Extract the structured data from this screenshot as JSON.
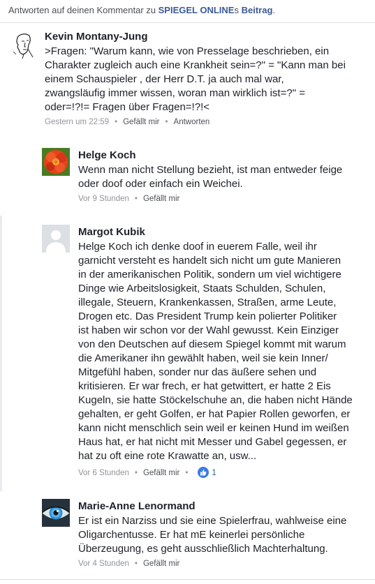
{
  "header": {
    "prefix": "Antworten auf deinen Kommentar zu ",
    "site": "SPIEGEL ONLINE",
    "suffix": "s ",
    "post": "Beitrag",
    "end": "."
  },
  "comments": [
    {
      "author": "Kevin Montany-Jung",
      "lines": [
        ">Fragen: \"Warum kann, wie  von Presselage beschrieben, ein",
        "Charakter zugleich  auch eine Krankheit sein=?\" = \"Kann man bei",
        "einem Schauspieler , der Herr D.T. ja auch mal war,",
        "zwangsläufig immer wissen, woran man wirklich ist=?\" =",
        "oder=!?!=  Fragen über Fragen=!?!<"
      ],
      "time": "Gestern um 22:59",
      "like": "Gefällt mir",
      "reply": "Antworten"
    },
    {
      "author": "Helge Koch",
      "lines": [
        "Wenn man nicht Stellung bezieht, ist man entweder feige",
        "oder doof oder einfach ein Weichei."
      ],
      "time": "Vor 9 Stunden",
      "like": "Gefällt mir"
    },
    {
      "author": "Margot Kubik",
      "lines": [
        "Helge Koch ich denke doof in euerem Falle, weil ihr",
        "garnicht versteht es handelt sich nicht um gute Manieren",
        "in der amerikanischen Politik, sondern um viel wichtigere",
        "Dinge wie Arbeitslosigkeit, Staats Schulden, Schulen,",
        "illegale, Steuern, Krankenkassen, Straßen, arme Leute,",
        "Drogen etc. Das President Trump kein polierter Politiker",
        "ist haben wir schon vor der Wahl gewusst. Kein Einziger",
        "von den Deutschen auf diesem Spiegel kommt mit warum",
        "die Amerikaner ihn gewählt haben, weil sie kein Inner/",
        "Mitgefühl haben, sonder nur das äußere sehen und",
        "kritisieren. Er war frech, er hat getwittert, er hatte 2 Eis",
        "Kugeln, sie hatte Stöckelschuhe an, die haben nicht Hände",
        "gehalten, er geht Golfen, er hat Papier Rollen geworfen, er",
        "kann nicht menschlich sein weil er keinen Hund im weißen",
        "Haus hat, er hat nicht mit Messer und Gabel gegessen, er",
        "hat zu oft eine rote Krawatte an, usw..."
      ],
      "time": "Vor 6 Stunden",
      "like": "Gefällt mir",
      "likes_count": "1"
    },
    {
      "author": "Marie-Anne Lenormand",
      "lines": [
        "Er ist ein Narziss und sie eine Spielerfrau, wahlweise eine",
        "Oligarchentusse. Er hat mE keinerlei persönliche",
        "Überzeugung, es geht ausschließlich Machterhaltung."
      ],
      "time": "Vor 4 Stunden",
      "like": "Gefällt mir"
    }
  ],
  "icons": {
    "sketch_avatar": "line-drawing-face-avatar",
    "flower_avatar": "red-flower-avatar",
    "default_avatar": "default-silhouette-avatar",
    "eye_avatar": "blue-eye-avatar",
    "like_badge": "thumbs-up-icon"
  },
  "colors": {
    "link": "#3b5998",
    "meta": "#90949c",
    "like_badge": "#3b7be6"
  }
}
